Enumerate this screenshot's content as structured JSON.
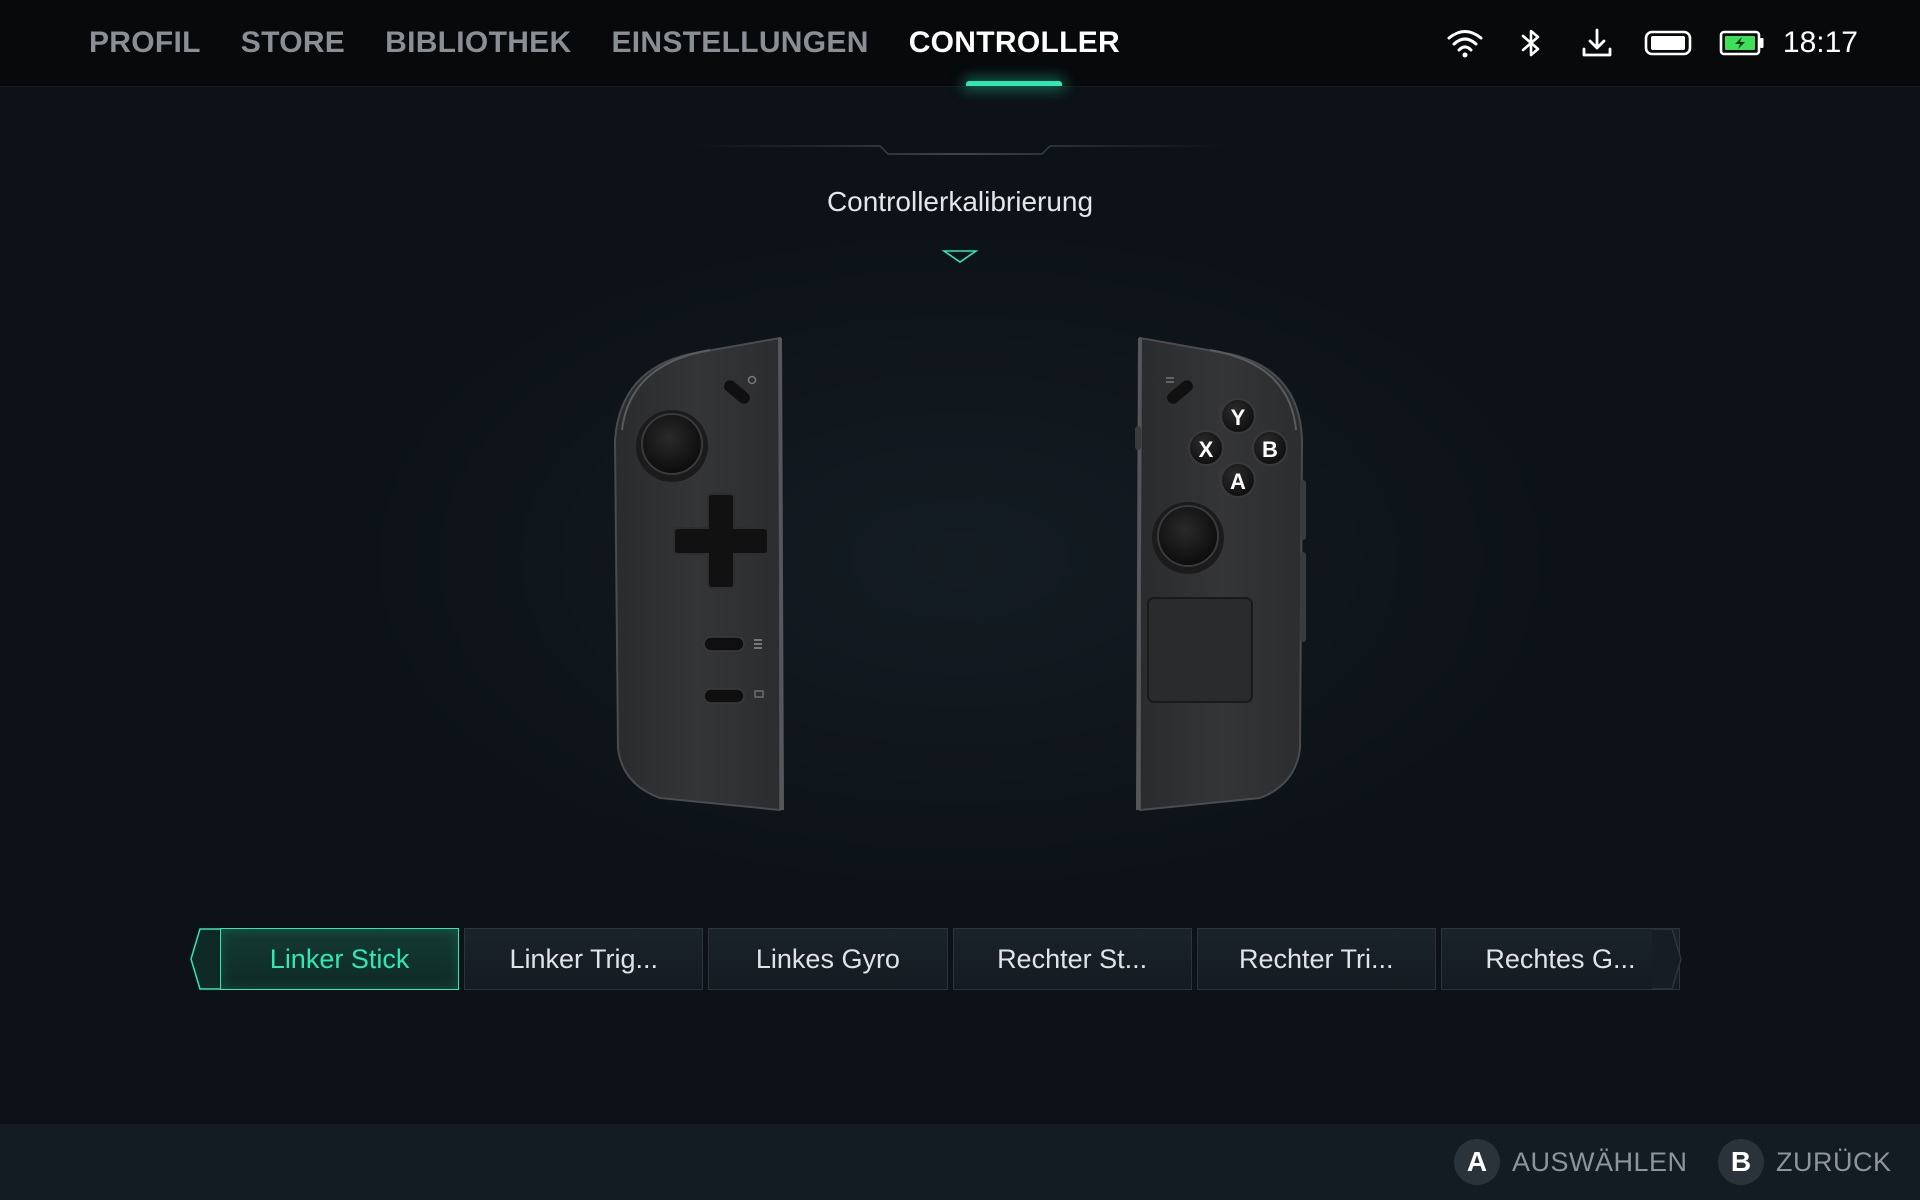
{
  "nav": {
    "tabs": [
      {
        "label": "PROFIL"
      },
      {
        "label": "STORE"
      },
      {
        "label": "BIBLIOTHEK"
      },
      {
        "label": "EINSTELLUNGEN"
      },
      {
        "label": "CONTROLLER"
      }
    ],
    "active_tab": "CONTROLLER",
    "accent_color": "#2ee8b6"
  },
  "status": {
    "icons": [
      "wifi-icon",
      "bluetooth-icon",
      "download-icon",
      "controller-battery-icon",
      "battery-charging-icon"
    ],
    "time": "18:17"
  },
  "page": {
    "title": "Controllerkalibrierung"
  },
  "controllers": {
    "right_buttons": {
      "y": "Y",
      "x": "X",
      "b": "B",
      "a": "A"
    }
  },
  "options": {
    "items": [
      {
        "label": "Linker Stick"
      },
      {
        "label": "Linker Trig..."
      },
      {
        "label": "Linkes Gyro"
      },
      {
        "label": "Rechter St..."
      },
      {
        "label": "Rechter Tri..."
      },
      {
        "label": "Rechtes G..."
      }
    ],
    "selected": "Linker Stick"
  },
  "footer": {
    "select": {
      "button": "A",
      "label": "AUSWÄHLEN"
    },
    "back": {
      "button": "B",
      "label": "ZURÜCK"
    }
  }
}
